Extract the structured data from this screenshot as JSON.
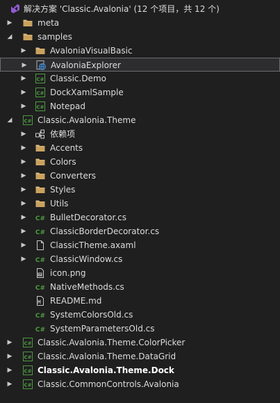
{
  "colors": {
    "background": "#1f1f1f",
    "folder": "#dcb67a",
    "csharp": "#4e9a42",
    "vb_globe": "#4a8ed6",
    "selection_border": "#6c6c6c",
    "text": "#dcdcdc"
  },
  "solution_explorer": {
    "rows": [
      {
        "label": "解决方案 'Classic.Avalonia' (12 个项目，共 12 个)",
        "icon": "solution-icon",
        "level": 0,
        "chevron": "none"
      },
      {
        "label": "meta",
        "icon": "folder-icon",
        "level": 1,
        "chevron": "collapsed"
      },
      {
        "label": "samples",
        "icon": "folder-icon",
        "level": 1,
        "chevron": "expanded"
      },
      {
        "label": "AvaloniaVisualBasic",
        "icon": "folder-icon",
        "level": 2,
        "chevron": "collapsed"
      },
      {
        "label": "AvaloniaExplorer",
        "icon": "vb-project-icon",
        "level": 2,
        "chevron": "collapsed",
        "selected": true
      },
      {
        "label": "Classic.Demo",
        "icon": "csharp-project-icon",
        "level": 2,
        "chevron": "collapsed"
      },
      {
        "label": "DockXamlSample",
        "icon": "csharp-project-icon",
        "level": 2,
        "chevron": "collapsed"
      },
      {
        "label": "Notepad",
        "icon": "csharp-project-icon",
        "level": 2,
        "chevron": "collapsed"
      },
      {
        "label": "Classic.Avalonia.Theme",
        "icon": "csharp-project-icon",
        "level": 1,
        "chevron": "expanded"
      },
      {
        "label": "依赖项",
        "icon": "dependencies-icon",
        "level": 2,
        "chevron": "collapsed"
      },
      {
        "label": "Accents",
        "icon": "folder-icon",
        "level": 2,
        "chevron": "collapsed"
      },
      {
        "label": "Colors",
        "icon": "folder-icon",
        "level": 2,
        "chevron": "collapsed"
      },
      {
        "label": "Converters",
        "icon": "folder-icon",
        "level": 2,
        "chevron": "collapsed"
      },
      {
        "label": "Styles",
        "icon": "folder-icon",
        "level": 2,
        "chevron": "collapsed"
      },
      {
        "label": "Utils",
        "icon": "folder-icon",
        "level": 2,
        "chevron": "collapsed"
      },
      {
        "label": "BulletDecorator.cs",
        "icon": "csharp-file-icon",
        "level": 2,
        "chevron": "collapsed"
      },
      {
        "label": "ClassicBorderDecorator.cs",
        "icon": "csharp-file-icon",
        "level": 2,
        "chevron": "collapsed"
      },
      {
        "label": "ClassicTheme.axaml",
        "icon": "axaml-file-icon",
        "level": 2,
        "chevron": "collapsed"
      },
      {
        "label": "ClassicWindow.cs",
        "icon": "csharp-file-icon",
        "level": 2,
        "chevron": "collapsed"
      },
      {
        "label": "icon.png",
        "icon": "image-file-icon",
        "level": 2,
        "chevron": "none"
      },
      {
        "label": "NativeMethods.cs",
        "icon": "csharp-file-icon",
        "level": 2,
        "chevron": "none"
      },
      {
        "label": "README.md",
        "icon": "markdown-file-icon",
        "level": 2,
        "chevron": "none"
      },
      {
        "label": "SystemColorsOld.cs",
        "icon": "csharp-file-icon",
        "level": 2,
        "chevron": "none"
      },
      {
        "label": "SystemParametersOld.cs",
        "icon": "csharp-file-icon",
        "level": 2,
        "chevron": "none"
      },
      {
        "label": "Classic.Avalonia.Theme.ColorPicker",
        "icon": "csharp-project-icon",
        "level": 1,
        "chevron": "collapsed"
      },
      {
        "label": "Classic.Avalonia.Theme.DataGrid",
        "icon": "csharp-project-icon",
        "level": 1,
        "chevron": "collapsed"
      },
      {
        "label": "Classic.Avalonia.Theme.Dock",
        "icon": "csharp-project-icon",
        "level": 1,
        "chevron": "collapsed",
        "bold": true
      },
      {
        "label": "Classic.CommonControls.Avalonia",
        "icon": "csharp-project-icon",
        "level": 1,
        "chevron": "collapsed"
      }
    ]
  }
}
